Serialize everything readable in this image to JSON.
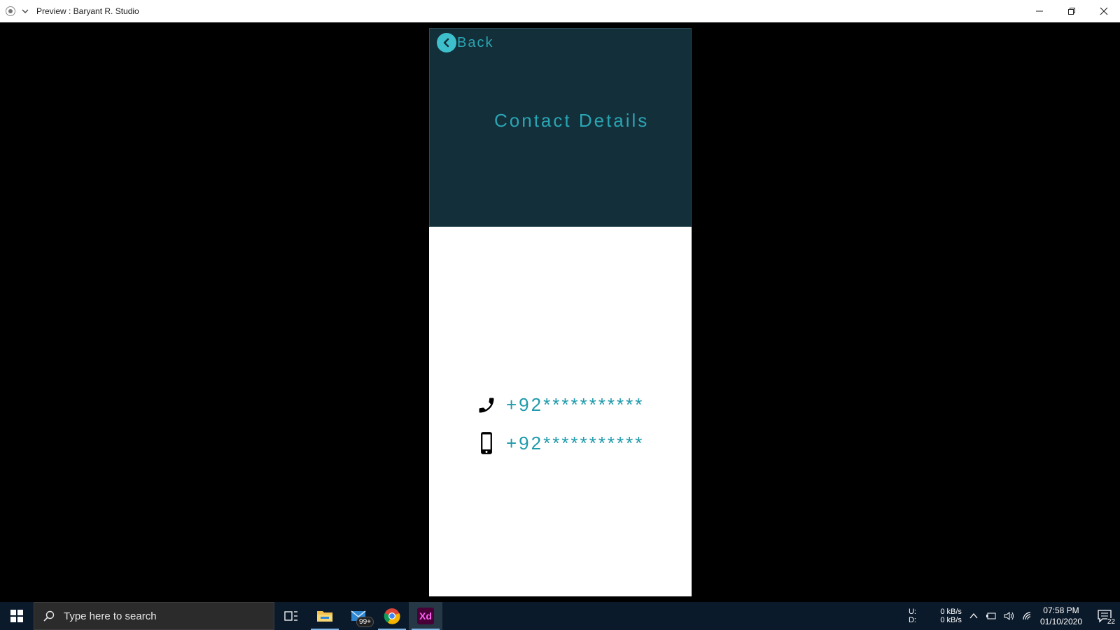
{
  "window": {
    "title": "Preview : Baryant R. Studio"
  },
  "screen": {
    "back_label": "Back",
    "title": "Contact Details",
    "contacts": [
      {
        "type": "phone",
        "icon": "phone-icon",
        "number": "+92***********"
      },
      {
        "type": "mobile",
        "icon": "smartphone-icon",
        "number": "+92***********"
      }
    ],
    "colors": {
      "header_bg": "#132f3a",
      "accent": "#2aa5b3"
    }
  },
  "taskbar": {
    "search_placeholder": "Type here to search",
    "mail_badge": "99+",
    "xd_label": "Xd",
    "net_up_label": "U:",
    "net_up_value": "0 kB/s",
    "net_down_label": "D:",
    "net_down_value": "0 kB/s",
    "time": "07:58 PM",
    "date": "01/10/2020",
    "notifications": "22"
  }
}
